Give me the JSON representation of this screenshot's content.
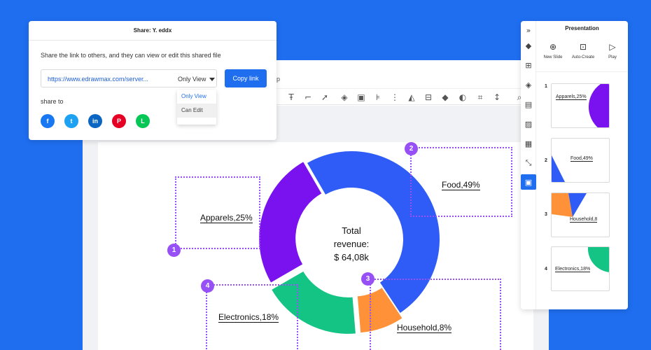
{
  "share": {
    "title": "Share: Y. eddx",
    "description": "Share the link to others, and they can view or edit this shared file",
    "link": "https://www.edrawmax.com/server...",
    "permission": "Only View",
    "copy_label": "Copy link",
    "share_to_label": "share to",
    "dropdown_options": [
      "Only View",
      "Can Edit"
    ],
    "socials": [
      {
        "name": "facebook",
        "glyph": "f",
        "color": "#1877f2"
      },
      {
        "name": "twitter",
        "glyph": "t",
        "color": "#1da1f2"
      },
      {
        "name": "linkedin",
        "glyph": "in",
        "color": "#0a66c2"
      },
      {
        "name": "pinterest",
        "glyph": "P",
        "color": "#e60023"
      },
      {
        "name": "line",
        "glyph": "L",
        "color": "#06c755"
      }
    ]
  },
  "menu_fragment": "lp",
  "presentation": {
    "title": "Presentation",
    "actions": [
      {
        "label": "New Slide",
        "icon": "plus-circle-icon"
      },
      {
        "label": "Auto-Create",
        "icon": "auto-create-icon"
      },
      {
        "label": "Play",
        "icon": "play-icon"
      }
    ],
    "slides": [
      {
        "number": "1",
        "label": "Apparels,25%"
      },
      {
        "number": "2",
        "label": "Food,49%"
      },
      {
        "number": "3",
        "label": "Household,8"
      },
      {
        "number": "4",
        "label": "Electronics,18%"
      }
    ]
  },
  "chart_data": {
    "type": "pie",
    "center_label": [
      "Total",
      "revenue:",
      "$ 64,08k"
    ],
    "categories": [
      "Food",
      "Household",
      "Electronics",
      "Apparels"
    ],
    "values": [
      49,
      8,
      18,
      25
    ],
    "labels": [
      "Food,49%",
      "Household,8%",
      "Electronics,18%",
      "Apparels,25%"
    ],
    "colors": {
      "Food": "#2f5cf6",
      "Household": "#ff9238",
      "Electronics": "#14c484",
      "Apparels": "#7a12f0"
    },
    "badges": [
      "1",
      "2",
      "3",
      "4"
    ],
    "accent": "#9650f5"
  }
}
